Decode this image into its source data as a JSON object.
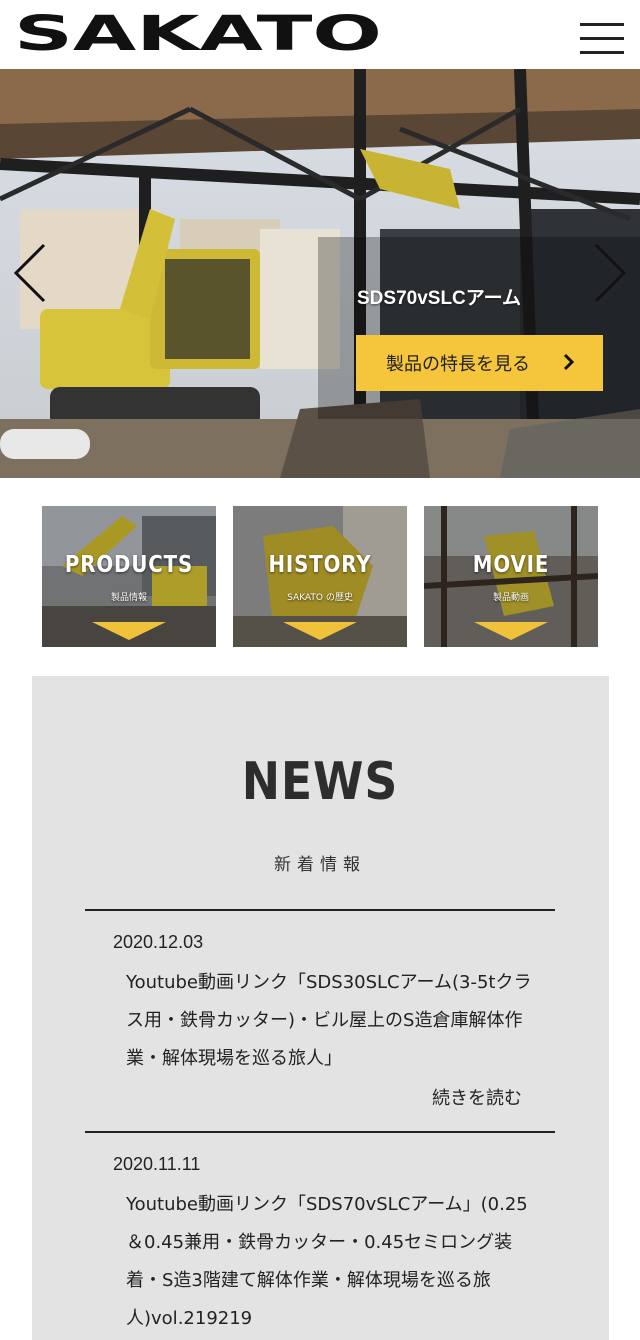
{
  "header": {
    "logo_text": "SAKATO",
    "menu_icon": "hamburger-icon"
  },
  "hero": {
    "caption": "SDS70vSLCアーム",
    "button_label": "製品の特長を見る",
    "prev_icon": "chevron-left-icon",
    "next_icon": "chevron-right-icon"
  },
  "tiles": [
    {
      "title": "PRODUCTS",
      "subtitle": "製品情報"
    },
    {
      "title": "HISTORY",
      "subtitle": "SAKATO の歴史"
    },
    {
      "title": "MOVIE",
      "subtitle": "製品動画"
    }
  ],
  "news": {
    "title": "NEWS",
    "subtitle": "新着情報",
    "items": [
      {
        "date": "2020.12.03",
        "text": "Youtube動画リンク「SDS30SLCアーム(3-5tクラス用・鉄骨カッター)・ビル屋上のS造倉庫解体作業・解体現場を巡る旅人」",
        "more": "続きを読む"
      },
      {
        "date": "2020.11.11",
        "text": "Youtube動画リンク「SDS70vSLCアーム」(0.25＆0.45兼用・鉄骨カッター・0.45セミロング装着・S造3階建て解体作業・解体現場を巡る旅人)vol.219219"
      }
    ]
  },
  "colors": {
    "accent": "#f5c53c",
    "news_bg": "#e3e3e3",
    "text": "#222222"
  }
}
